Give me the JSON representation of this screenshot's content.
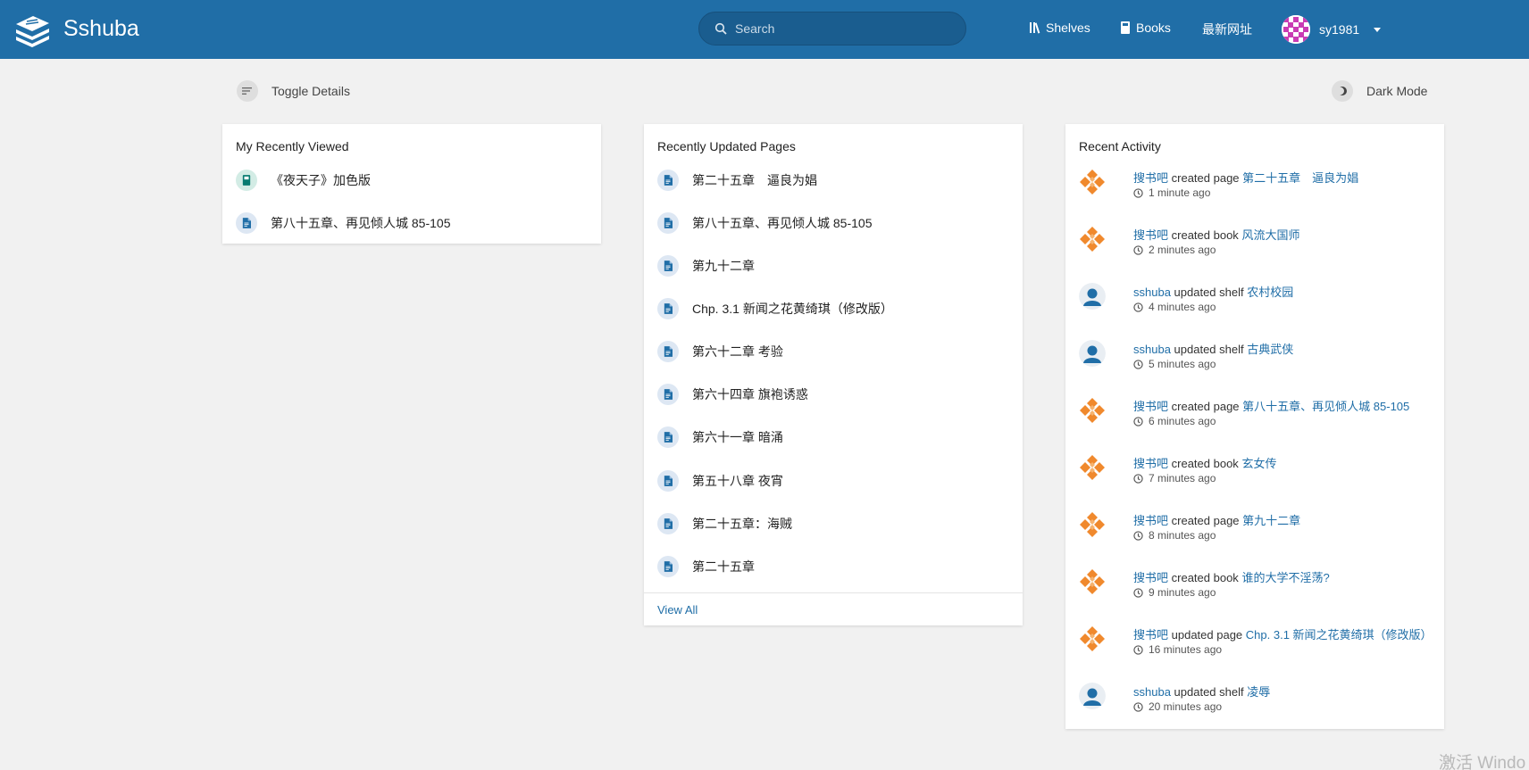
{
  "header": {
    "site_name": "Sshuba",
    "search_placeholder": "Search",
    "nav": [
      {
        "label": "Shelves",
        "icon": "shelves-icon"
      },
      {
        "label": "Books",
        "icon": "books-icon"
      },
      {
        "label": "最新网址",
        "icon": ""
      }
    ],
    "user": {
      "name": "sy1981"
    }
  },
  "actions": {
    "toggle_details": "Toggle Details",
    "dark_mode": "Dark Mode"
  },
  "recently_viewed": {
    "title": "My Recently Viewed",
    "items": [
      {
        "label": "《夜天子》加色版",
        "type": "book"
      },
      {
        "label": "第八十五章、再见倾人城 85-105",
        "type": "page"
      }
    ]
  },
  "recently_updated": {
    "title": "Recently Updated Pages",
    "items": [
      {
        "label": "第二十五章　逼良为娼"
      },
      {
        "label": "第八十五章、再见倾人城 85-105"
      },
      {
        "label": "第九十二章"
      },
      {
        "label": "Chp. 3.1 新闻之花黄绮琪（修改版）"
      },
      {
        "label": "第六十二章 考验"
      },
      {
        "label": "第六十四章 旗袍诱惑"
      },
      {
        "label": "第六十一章 暗涌"
      },
      {
        "label": "第五十八章 夜宵"
      },
      {
        "label": "第二十五章：海贼"
      },
      {
        "label": "第二十五章"
      }
    ],
    "view_all": "View All"
  },
  "recent_activity": {
    "title": "Recent Activity",
    "items": [
      {
        "user": "搜书吧",
        "action": "created page",
        "target": "第二十五章　逼良为娼",
        "time": "1 minute ago",
        "avatar": "orange"
      },
      {
        "user": "搜书吧",
        "action": "created book",
        "target": "风流大国师",
        "time": "2 minutes ago",
        "avatar": "orange"
      },
      {
        "user": "sshuba",
        "action": "updated shelf",
        "target": "农村校园",
        "time": "4 minutes ago",
        "avatar": "default"
      },
      {
        "user": "sshuba",
        "action": "updated shelf",
        "target": "古典武侠",
        "time": "5 minutes ago",
        "avatar": "default"
      },
      {
        "user": "搜书吧",
        "action": "created page",
        "target": "第八十五章、再见倾人城 85-105",
        "time": "6 minutes ago",
        "avatar": "orange"
      },
      {
        "user": "搜书吧",
        "action": "created book",
        "target": "玄女传",
        "time": "7 minutes ago",
        "avatar": "orange"
      },
      {
        "user": "搜书吧",
        "action": "created page",
        "target": "第九十二章",
        "time": "8 minutes ago",
        "avatar": "orange"
      },
      {
        "user": "搜书吧",
        "action": "created book",
        "target": "谁的大学不淫荡?",
        "time": "9 minutes ago",
        "avatar": "orange"
      },
      {
        "user": "搜书吧",
        "action": "updated page",
        "target": "Chp. 3.1 新闻之花黄绮琪（修改版）",
        "time": "16 minutes ago",
        "avatar": "orange"
      },
      {
        "user": "sshuba",
        "action": "updated shelf",
        "target": "凌辱",
        "time": "20 minutes ago",
        "avatar": "default"
      }
    ]
  },
  "watermark": "激活 Windo",
  "colors": {
    "header_bg": "#206ea7",
    "link": "#206ea7",
    "page_bg": "#f1f1f1",
    "activity_avatar_orange": "#f0892d"
  }
}
